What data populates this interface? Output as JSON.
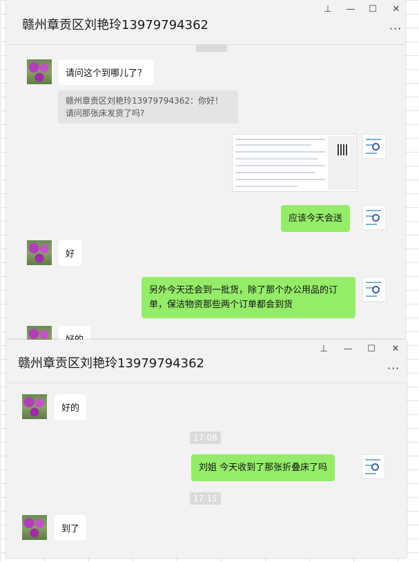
{
  "window1": {
    "title": "赣州章贡区刘艳玲13979794362",
    "controls": {
      "pin": "⊥",
      "minimize": "—",
      "maximize": "☐",
      "close": "✕",
      "more": "···"
    },
    "messages": [
      {
        "side": "in",
        "text": "请问这个到哪儿了？"
      },
      {
        "side": "quote",
        "text": "赣州章贡区刘艳玲13979794362：你好！请问那张床发货了吗?"
      },
      {
        "side": "out-image"
      },
      {
        "side": "out",
        "text": "应该今天会送"
      },
      {
        "side": "in",
        "text": "好"
      },
      {
        "side": "out",
        "text": "另外今天还会到一批货，除了那个办公用品的订单，保洁物资那些两个订单都会到货"
      },
      {
        "side": "in",
        "text": "好的"
      }
    ]
  },
  "window2": {
    "title": "赣州章贡区刘艳玲13979794362",
    "controls": {
      "pin": "⊥",
      "minimize": "—",
      "maximize": "☐",
      "close": "✕",
      "more": "···"
    },
    "messages": [
      {
        "side": "in",
        "text": "好的"
      },
      {
        "side": "time",
        "text": "17:08"
      },
      {
        "side": "out",
        "text": "刘姐  今天收到了那张折叠床了吗"
      },
      {
        "side": "time",
        "text": "17:15"
      },
      {
        "side": "in",
        "text": "到了"
      }
    ]
  },
  "colors": {
    "outgoing_bubble": "#95ec69",
    "incoming_bubble": "#ffffff",
    "chat_background": "#f2f2f2"
  },
  "icons": [
    "pin-icon",
    "minimize-icon",
    "maximize-icon",
    "close-icon",
    "more-icon",
    "avatar",
    "avatar-thumbnail"
  ]
}
